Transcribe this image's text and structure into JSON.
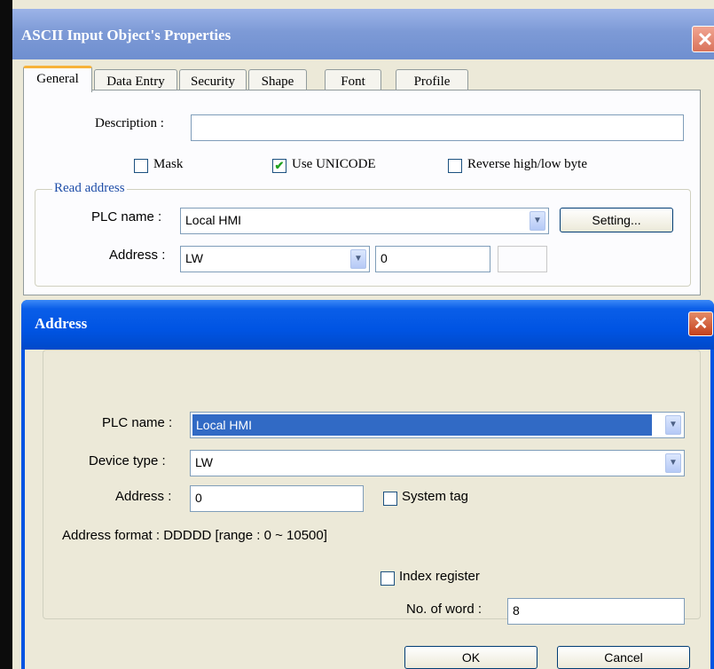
{
  "back_window": {
    "title": "ASCII Input Object's Properties",
    "close_glyph": "✕",
    "tabs": [
      "General",
      "Data Entry",
      "Security",
      "Shape",
      "Font",
      "Profile"
    ],
    "description_label": "Description :",
    "description_value": "",
    "mask_label": "Mask",
    "mask_checked": false,
    "use_unicode_label": "Use UNICODE",
    "use_unicode_checked": true,
    "reverse_label": "Reverse high/low byte",
    "reverse_checked": false,
    "read_address": {
      "title": "Read address",
      "plc_name_label": "PLC name :",
      "plc_name_value": "Local HMI",
      "setting_button": "Setting...",
      "address_label": "Address :",
      "device_value": "LW",
      "address_value": "0"
    }
  },
  "address_dialog": {
    "title": "Address",
    "close_glyph": "✕",
    "plc_name_label": "PLC name :",
    "plc_name_value": "Local HMI",
    "device_type_label": "Device type :",
    "device_type_value": "LW",
    "address_label": "Address :",
    "address_value": "0",
    "system_tag_label": "System tag",
    "system_tag_checked": false,
    "address_format": "Address format : DDDDD [range : 0 ~ 10500]",
    "index_register_label": "Index register",
    "index_register_checked": false,
    "no_of_word_label": "No. of word :",
    "no_of_word_value": "8",
    "ok_button": "OK",
    "cancel_button": "Cancel"
  },
  "colors": {
    "xp_blue_title": "#0054e3",
    "back_title_faded": "#7d9ad6",
    "selection_blue": "#316ac5",
    "check_green": "#21a121",
    "group_title_blue": "#1f4ea8"
  },
  "icons": {
    "dropdown": "chevron-down-icon",
    "check": "checkmark-icon",
    "close": "close-icon"
  }
}
